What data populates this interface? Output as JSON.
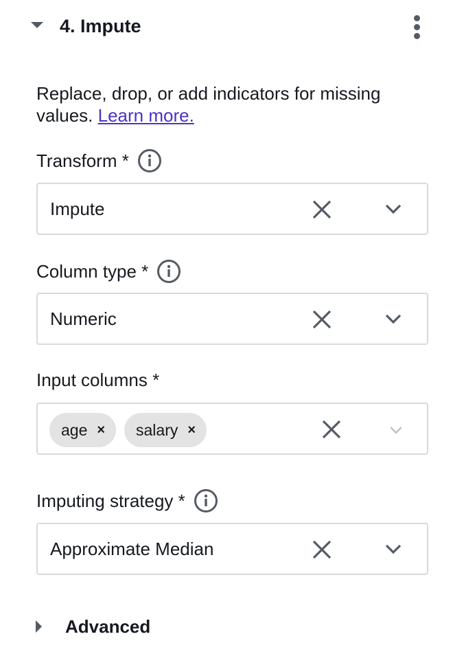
{
  "section": {
    "title": "4. Impute",
    "description": "Replace, drop, or add indicators for missing values.",
    "learn_more": "Learn more."
  },
  "transform": {
    "label": "Transform *",
    "value": "Impute"
  },
  "column_type": {
    "label": "Column type *",
    "value": "Numeric"
  },
  "input_columns": {
    "label": "Input columns *",
    "chips": [
      "age",
      "salary"
    ],
    "chip_remove": "×"
  },
  "imputing_strategy": {
    "label": "Imputing strategy *",
    "value": "Approximate Median"
  },
  "advanced": {
    "label": "Advanced"
  },
  "icons": {
    "collapse": "caret-down-icon",
    "expand": "caret-right-icon",
    "menu": "more-vertical-icon",
    "info": "info-icon",
    "clear": "close-icon",
    "dropdown": "chevron-down-icon"
  },
  "colors": {
    "link": "#4b33c7",
    "icon": "#545b64",
    "chip_bg": "#e3e3e3",
    "border": "#d5dbdb"
  }
}
